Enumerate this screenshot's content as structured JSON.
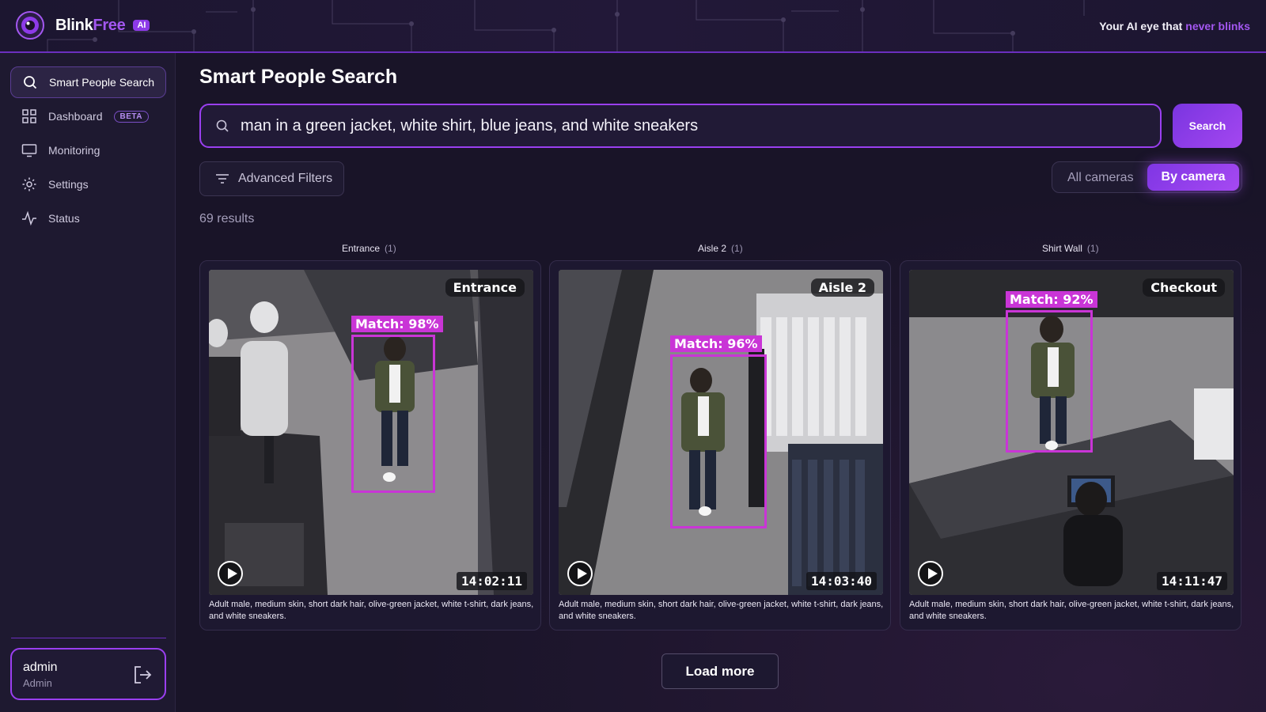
{
  "header": {
    "logo_blink": "Blink",
    "logo_free": "Free",
    "ai_badge": "AI",
    "tagline_prefix": "Your AI eye that",
    "tagline_highlight": "never blinks",
    "accent_color": "#a357f0"
  },
  "sidebar": {
    "items": [
      {
        "label": "Smart People Search",
        "icon": "search-icon",
        "active": true
      },
      {
        "label": "Dashboard",
        "icon": "grid-icon",
        "badge": "BETA"
      },
      {
        "label": "Monitoring",
        "icon": "monitor-icon"
      },
      {
        "label": "Settings",
        "icon": "gear-icon"
      },
      {
        "label": "Status",
        "icon": "activity-icon"
      }
    ],
    "user": {
      "name": "admin",
      "role": "Admin",
      "logout_icon": "logout-icon"
    }
  },
  "main": {
    "title": "Smart People Search",
    "search": {
      "value": "man in a green jacket, white shirt, blue jeans, and white sneakers",
      "button_label": "Search"
    },
    "advanced_filters_label": "Advanced Filters",
    "view_toggle": {
      "all": "All cameras",
      "by_camera": "By camera",
      "selected": "By camera"
    },
    "results_count": "69 results",
    "groups": [
      {
        "name": "Entrance",
        "count": "(1)"
      },
      {
        "name": "Aisle 2",
        "count": "(1)"
      },
      {
        "name": "Shirt Wall",
        "count": "(1)"
      }
    ],
    "cards": [
      {
        "camera": "Entrance",
        "match": "Match: 98%",
        "time": "14:02:11",
        "description": "Adult male, medium skin, short dark hair, olive-green jacket, white t-shirt, dark jeans, and white sneakers."
      },
      {
        "camera": "Aisle 2",
        "match": "Match: 96%",
        "time": "14:03:40",
        "description": "Adult male, medium skin, short dark hair, olive-green jacket, white t-shirt, dark jeans, and white sneakers."
      },
      {
        "camera": "Checkout",
        "match": "Match: 92%",
        "time": "14:11:47",
        "description": "Adult male, medium skin, short dark hair, olive-green jacket, white t-shirt, dark jeans, and white sneakers."
      }
    ],
    "load_more_label": "Load more"
  }
}
